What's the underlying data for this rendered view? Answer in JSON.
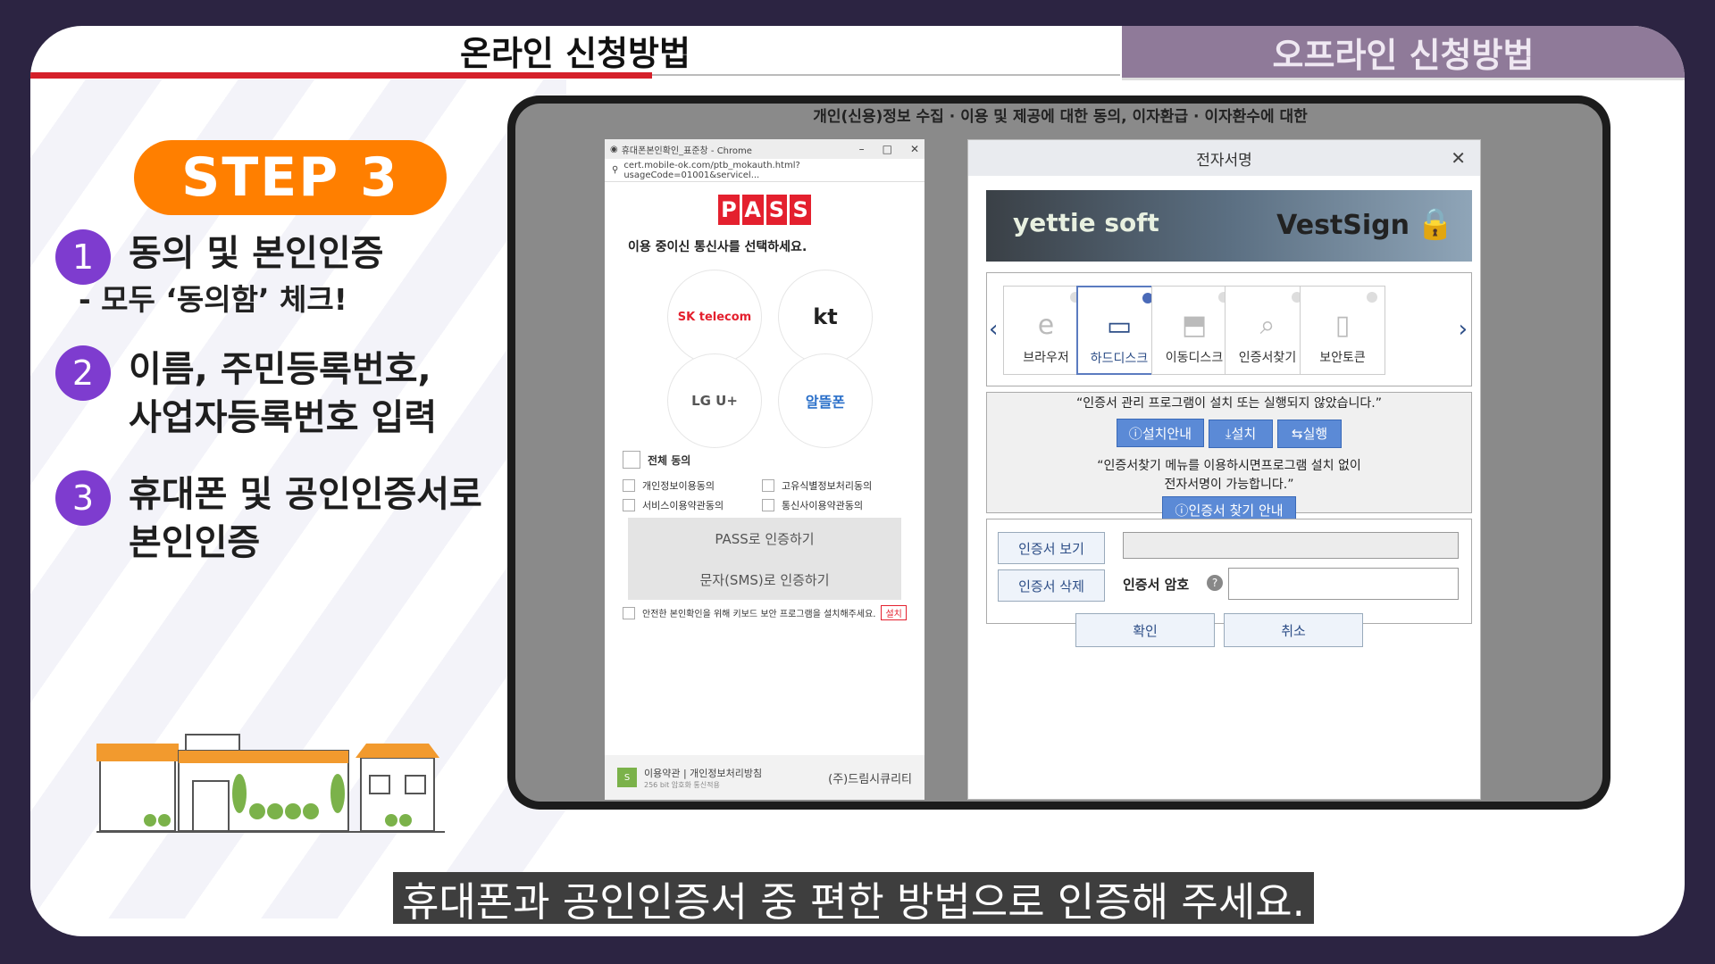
{
  "tabs": {
    "online": "온라인 신청방법",
    "offline": "오프라인 신청방법"
  },
  "step": "STEP 3",
  "steps": [
    {
      "num": "1",
      "title": "동의 및 본인인증",
      "sub": "- 모두 ‘동의함’ 체크!"
    },
    {
      "num": "2",
      "title": "이름, 주민등록번호,",
      "title2": "사업자등록번호 입력"
    },
    {
      "num": "3",
      "title": "휴대폰 및 공인인증서로",
      "title2": "본인인증"
    }
  ],
  "bg_header": "개인(신용)정보 수집 · 이용 및 제공에 대한 동의, 이자환급 · 이자환수에 대한",
  "pass": {
    "window_title": "휴대폰본인확인_표준창 - Chrome",
    "url": "cert.mobile-ok.com/ptb_mokauth.html?usageCode=01001&servicel...",
    "logo": [
      "P",
      "A",
      "S",
      "S"
    ],
    "select_label": "이용 중이신 통신사를 선택하세요.",
    "carriers": [
      "SK telecom",
      "kt",
      "LG U+",
      "알뜰폰"
    ],
    "agree_all": "전체 동의",
    "agree_items": [
      "개인정보이용동의",
      "고유식별정보처리동의",
      "서비스이용약관동의",
      "통신사이용약관동의"
    ],
    "btn_pass": "PASS로 인증하기",
    "btn_sms": "문자(SMS)로 인증하기",
    "keyboard_note": "안전한 본인확인을 위해 키보드 보안 프로그램을 설치해주세요.",
    "install": "설치",
    "footer_links": "이용약관 | 개인정보처리방침",
    "footer_small": "256 bit 암호화 통신적용",
    "company": "(주)드림시큐리티"
  },
  "sign": {
    "title": "전자서명",
    "brand_left": "yettie soft",
    "brand_right": "VestSign",
    "devices": [
      "브라우저",
      "하드디스크",
      "이동디스크",
      "인증서찾기",
      "보안토큰"
    ],
    "msg1": "“인증서 관리 프로그램이 설치 또는 실행되지 않았습니다.”",
    "btn_guide": "설치안내",
    "btn_install": "설치",
    "btn_run": "실행",
    "msg2a": "“인증서찾기 메뉴를 이용하시면프로그램 설치 없이",
    "msg2b": "전자서명이 가능합니다.”",
    "btn_find": "인증서 찾기 안내",
    "btn_view": "인증서 보기",
    "btn_delete": "인증서 삭제",
    "pw_label": "인증서 암호",
    "ok": "확인",
    "cancel": "취소"
  },
  "subtitle": "휴대폰과 공인인증서 중 편한 방법으로 인증해 주세요."
}
